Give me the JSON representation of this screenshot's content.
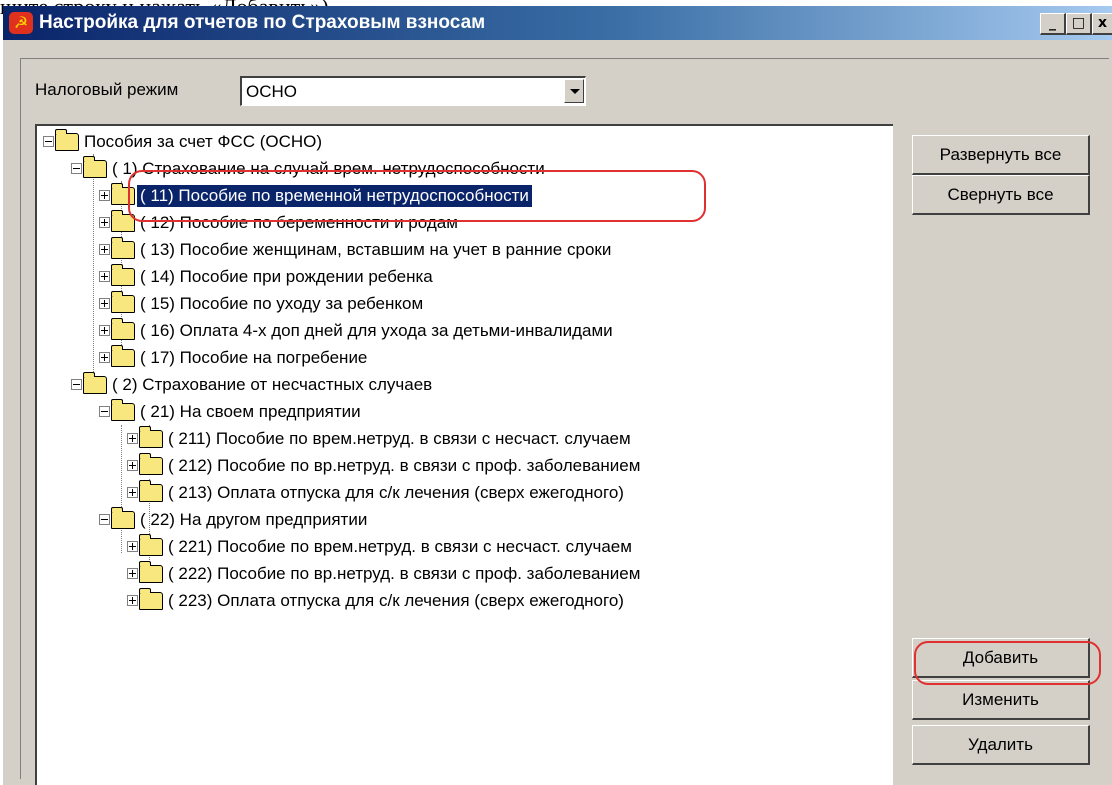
{
  "background_text": "шите строку и нажать «Добавить»).",
  "window": {
    "title": "Настройка для отчетов по Страховым взносам",
    "icon": "app-icon",
    "title_buttons": [
      "_",
      "□",
      "x"
    ]
  },
  "tax_mode": {
    "label": "Налоговый режим",
    "value": "ОСНО"
  },
  "tree": {
    "root": "Пособия за счет ФСС (ОСНО)",
    "g1": "(   1)  Страхование на случай врем. нетрудоспособности",
    "g1_items": [
      "(   11)  Пособие по временной нетрудоспособности",
      "(   12)  Пособие по беременности и родам",
      "(   13)  Пособие женщинам, вставшим на учет в ранние сроки",
      "(   14)  Пособие при рождении ребенка",
      "(   15)  Пособие по уходу за ребенком",
      "(   16)  Оплата 4-х доп дней для ухода за детьми-инвалидами",
      "(   17)  Пособие на погребение"
    ],
    "g2": "(   2)  Страхование от несчастных случаев",
    "g21": "(   21)  На своем предприятии",
    "g21_items": [
      "( 211)  Пособие по врем.нетруд. в связи с несчаст. случаем",
      "( 212)  Пособие по вр.нетруд. в связи с проф. заболеванием",
      "( 213)  Оплата отпуска для с/к лечения (сверх ежегодного)"
    ],
    "g22": "(   22)  На другом предприятии",
    "g22_items": [
      "( 221)  Пособие по врем.нетруд. в связи с несчаст. случаем",
      "( 222)  Пособие по вр.нетруд. в связи с проф. заболеванием",
      "( 223)  Оплата отпуска для с/к лечения (сверх ежегодного)"
    ],
    "selected": "(   11)  Пособие по временной нетрудоспособности"
  },
  "buttons": {
    "expand_all": "Развернуть все",
    "collapse_all": "Свернуть все",
    "add": "Добавить",
    "edit": "Изменить",
    "delete": "Удалить"
  },
  "colors": {
    "selection": "#0a246a",
    "highlight": "#e03030",
    "folder": "#f7e77e"
  }
}
